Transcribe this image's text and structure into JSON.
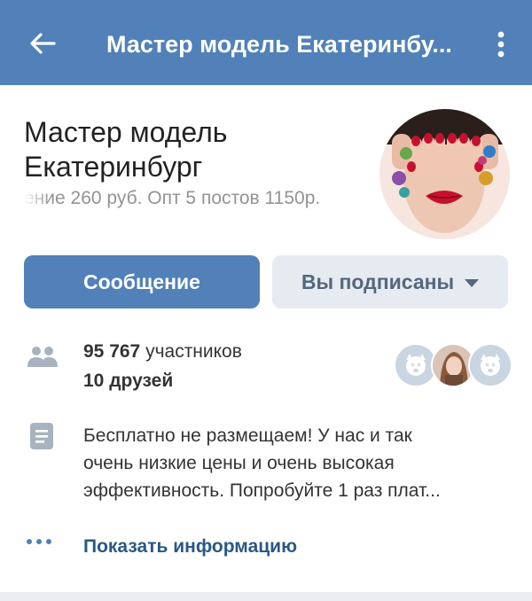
{
  "header": {
    "title": "Мастер модель Екатеринбу...",
    "back_icon": "arrow-left-icon",
    "more_icon": "more-vertical-icon",
    "background": "#5181b8"
  },
  "group": {
    "name_line1": "Мастер модель",
    "name_line2": "Екатеринбург",
    "status": "ение 260 руб. Опт 5 постов 1150р."
  },
  "actions": {
    "message_label": "Сообщение",
    "subscribed_label": "Вы подписаны",
    "accent": "#5181b8"
  },
  "members": {
    "count": "95 767",
    "count_suffix": " участников",
    "friends": "10 друзей",
    "icon": "people-icon"
  },
  "description": {
    "icon": "document-icon",
    "line1": "Бесплатно не размещаем! У нас и так",
    "line2": "очень низкие цены и очень высокая",
    "line3": "эффективность. Попробуйте 1 раз плат..."
  },
  "more_info": {
    "label": "Показать информацию",
    "icon": "more-dots-icon"
  }
}
